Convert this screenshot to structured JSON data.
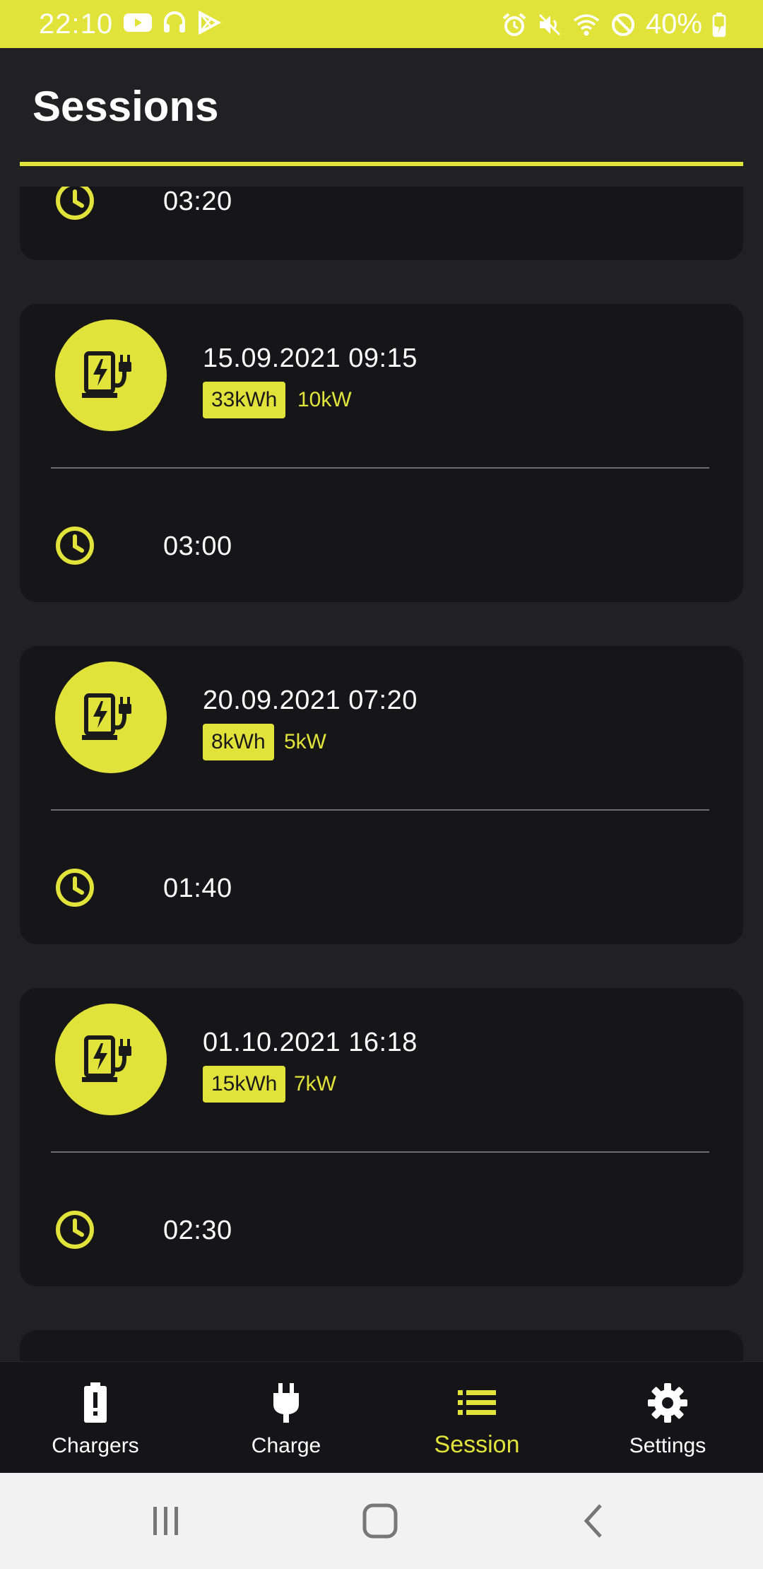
{
  "status_bar": {
    "time": "22:10",
    "battery": "40%",
    "left_icons": [
      "youtube-icon",
      "headphones-icon",
      "play-store-icon"
    ],
    "right_icons": [
      "alarm-icon",
      "mute-icon",
      "wifi-icon",
      "do-not-disturb-icon",
      "battery-charging-icon"
    ]
  },
  "app_bar": {
    "title": "Sessions",
    "accent": "#e2e33a"
  },
  "sessions": [
    {
      "date": "",
      "energy": "",
      "power": "",
      "duration": "03:20"
    },
    {
      "date": "15.09.2021 09:15",
      "energy": "33kWh",
      "power": "10kW",
      "duration": "03:00"
    },
    {
      "date": "20.09.2021 07:20",
      "energy": "8kWh",
      "power": "5kW",
      "duration": "01:40"
    },
    {
      "date": "01.10.2021 16:18",
      "energy": "15kWh",
      "power": "7kW",
      "duration": "02:30"
    }
  ],
  "bottom_nav": {
    "items": [
      {
        "label": "Chargers",
        "icon": "battery-alert-icon"
      },
      {
        "label": "Charge",
        "icon": "plug-icon"
      },
      {
        "label": "Session",
        "icon": "list-icon",
        "active": true
      },
      {
        "label": "Settings",
        "icon": "gear-icon"
      }
    ]
  },
  "system_nav": [
    "recents-button",
    "home-button",
    "back-button"
  ]
}
